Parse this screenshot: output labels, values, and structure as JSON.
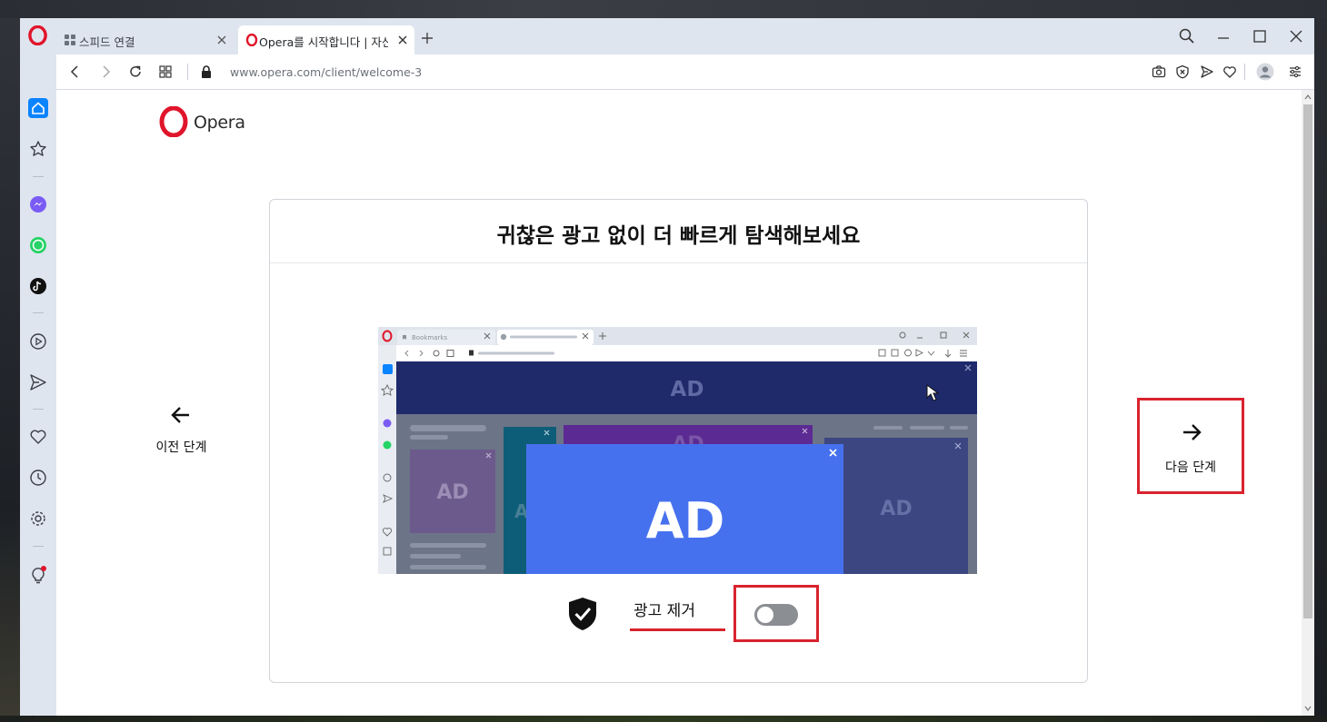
{
  "tabs": [
    {
      "label": "스피드 연결",
      "icon": "grid-icon",
      "active": false
    },
    {
      "label": "Opera를 시작합니다 | 자신",
      "icon": "opera-icon",
      "active": true
    }
  ],
  "address": {
    "url": "www.opera.com/client/welcome-3"
  },
  "page": {
    "brand": "Opera",
    "title": "귀찮은 광고 없이 더 빠르게 탐색해보세요",
    "adblock_label": "광고 제거",
    "adblock_enabled": false,
    "prev_label": "이전 단계",
    "next_label": "다음 단계",
    "progress_fraction": 0.4,
    "illustration": {
      "tab_label": "Bookmarks",
      "ad_text": "AD"
    }
  },
  "colors": {
    "accent_red": "#d9232e",
    "opera_red": "#e0152b",
    "sidebar_bg": "#dfe5ef",
    "ad_blue": "#4671ee",
    "ad_navy": "#1f2a6b",
    "progress_knob": "#0c2c8f"
  },
  "sidebar_icons": [
    "home-icon",
    "star-icon",
    "messenger-icon",
    "whatsapp-icon",
    "tiktok-icon",
    "player-icon",
    "send-icon",
    "heart-icon",
    "history-icon",
    "settings-icon",
    "lightbulb-icon"
  ]
}
